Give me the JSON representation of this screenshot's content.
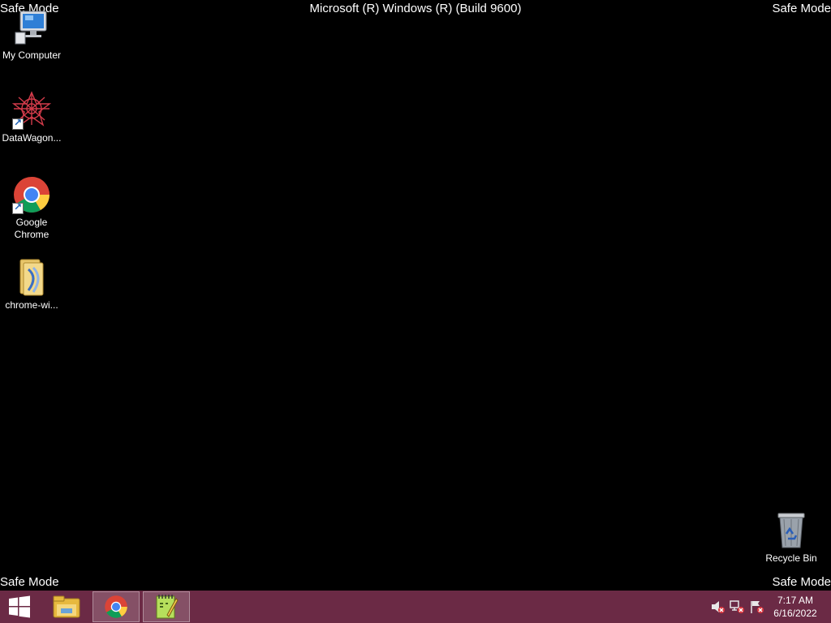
{
  "overlay": {
    "safe_mode": "Safe Mode",
    "build_title": "Microsoft (R) Windows (R) (Build 9600)"
  },
  "desktop": {
    "icons": [
      {
        "label": "My Computer",
        "icon": "computer-icon"
      },
      {
        "label": "DataWagon...",
        "icon": "datawagon-icon"
      },
      {
        "label": "Google Chrome",
        "icon": "chrome-icon"
      },
      {
        "label": "chrome-wi...",
        "icon": "folder-icon"
      },
      {
        "label": "Recycle Bin",
        "icon": "recycle-bin-icon"
      }
    ]
  },
  "taskbar": {
    "background": "#6b2a45",
    "buttons": [
      {
        "name": "file-explorer",
        "icon": "folder-icon"
      },
      {
        "name": "google-chrome",
        "icon": "chrome-icon"
      },
      {
        "name": "notepad-plus-plus",
        "icon": "notepad-icon"
      }
    ],
    "tray": {
      "icons": [
        "speaker-muted-icon",
        "network-disconnected-icon",
        "action-center-flag-icon"
      ],
      "time": "7:17 AM",
      "date": "6/16/2022"
    }
  }
}
